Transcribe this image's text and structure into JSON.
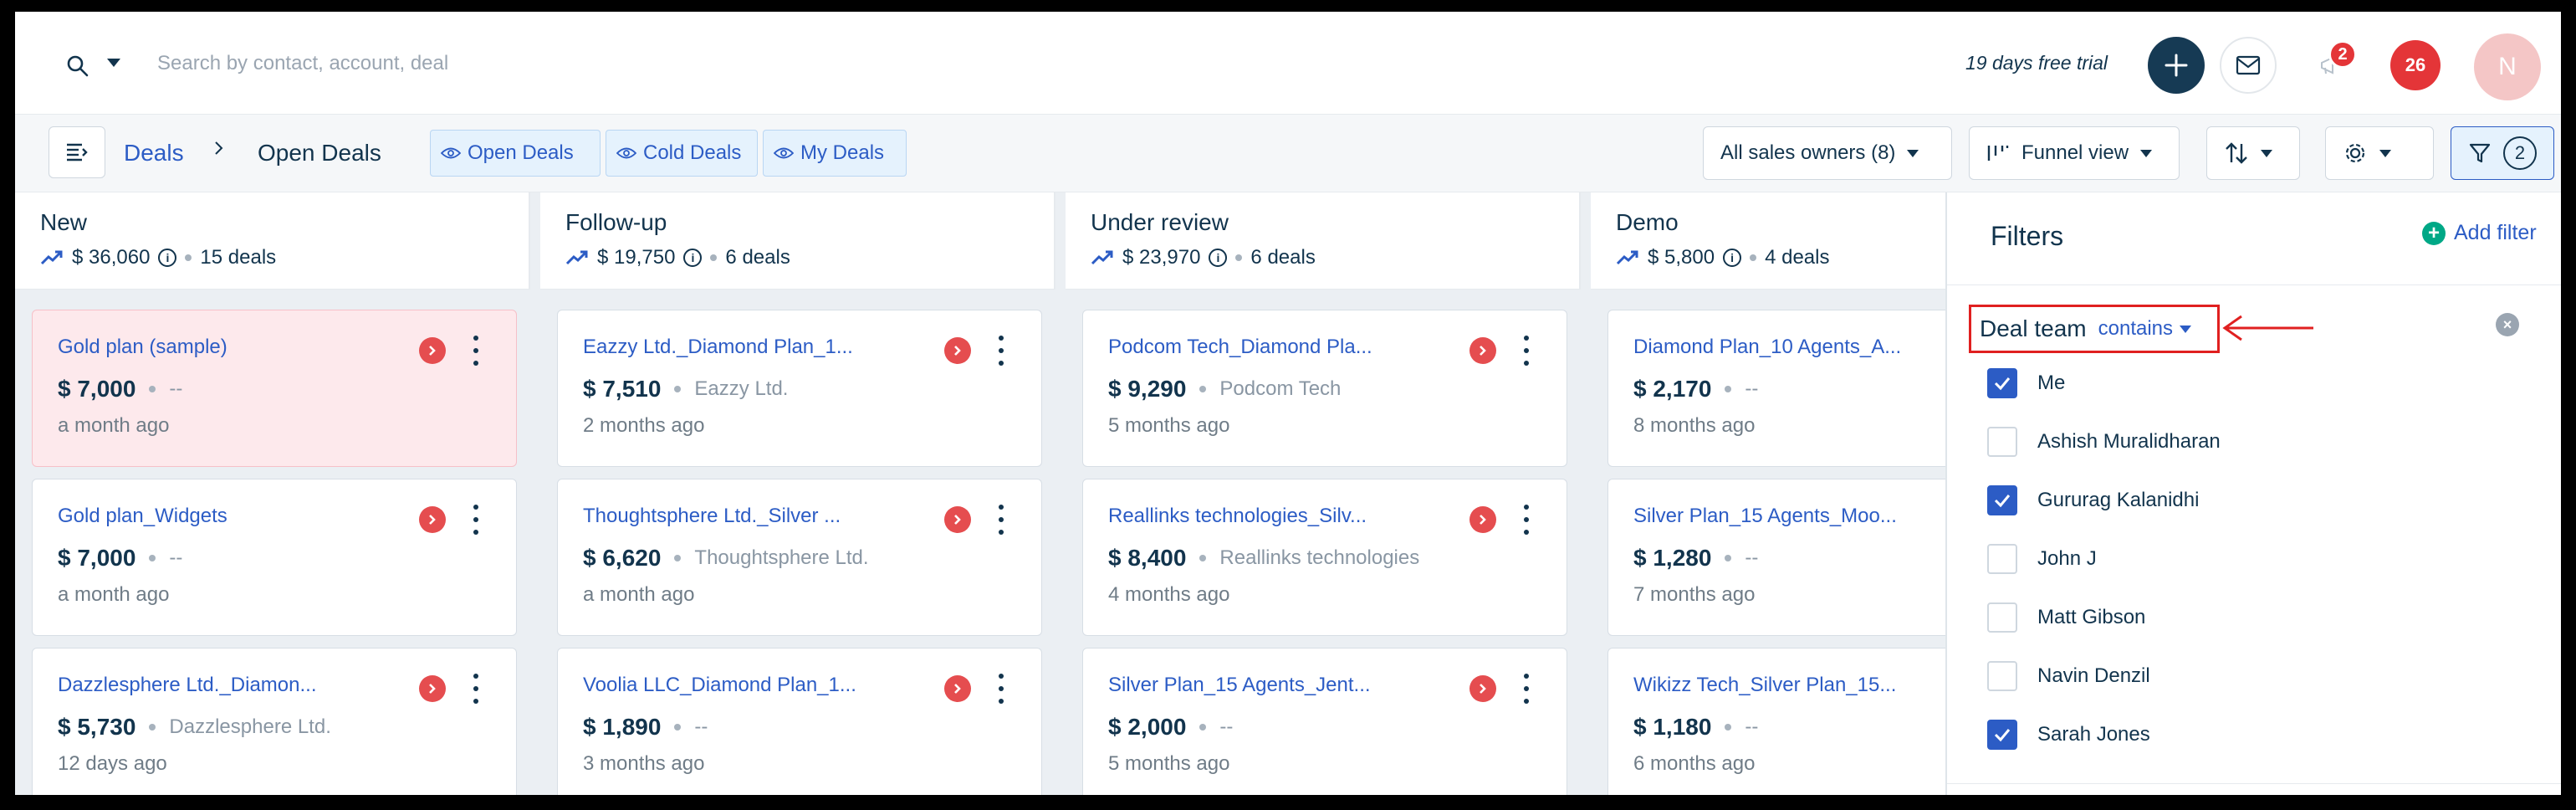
{
  "topbar": {
    "search_placeholder": "Search by contact, account, deal",
    "trial_text": "19 days free trial",
    "notification_count": "2",
    "alerts_count": "26",
    "avatar_initial": "N"
  },
  "subheader": {
    "breadcrumb_root": "Deals",
    "breadcrumb_current": "Open Deals",
    "view_chips": [
      "Open Deals",
      "Cold Deals",
      "My Deals"
    ],
    "owners_label": "All sales owners (8)",
    "view_mode_label": "Funnel view",
    "filter_count": "2"
  },
  "columns": [
    {
      "title": "New",
      "amount": "$ 36,060",
      "count": "15 deals",
      "cards": [
        {
          "title": "Gold plan (sample)",
          "amount": "$ 7,000",
          "account": "--",
          "time": "a month ago"
        },
        {
          "title": "Gold plan_Widgets",
          "amount": "$ 7,000",
          "account": "--",
          "time": "a month ago"
        },
        {
          "title": "Dazzlesphere Ltd._Diamon...",
          "amount": "$ 5,730",
          "account": "Dazzlesphere Ltd.",
          "time": "12 days ago"
        }
      ]
    },
    {
      "title": "Follow-up",
      "amount": "$ 19,750",
      "count": "6 deals",
      "cards": [
        {
          "title": "Eazzy Ltd._Diamond Plan_1...",
          "amount": "$ 7,510",
          "account": "Eazzy Ltd.",
          "time": "2 months ago"
        },
        {
          "title": "Thoughtsphere Ltd._Silver ...",
          "amount": "$ 6,620",
          "account": "Thoughtsphere Ltd.",
          "time": "a month ago"
        },
        {
          "title": "Voolia LLC_Diamond Plan_1...",
          "amount": "$ 1,890",
          "account": "--",
          "time": "3 months ago"
        }
      ]
    },
    {
      "title": "Under review",
      "amount": "$ 23,970",
      "count": "6 deals",
      "cards": [
        {
          "title": "Podcom Tech_Diamond Pla...",
          "amount": "$ 9,290",
          "account": "Podcom Tech",
          "time": "5 months ago"
        },
        {
          "title": "Reallinks technologies_Silv...",
          "amount": "$ 8,400",
          "account": "Reallinks technologies",
          "time": "4 months ago"
        },
        {
          "title": "Silver Plan_15 Agents_Jent...",
          "amount": "$ 2,000",
          "account": "--",
          "time": "5 months ago"
        }
      ]
    },
    {
      "title": "Demo",
      "amount": "$ 5,800",
      "count": "4 deals",
      "cards": [
        {
          "title": "Diamond Plan_10 Agents_A...",
          "amount": "$ 2,170",
          "account": "--",
          "time": "8 months ago"
        },
        {
          "title": "Silver Plan_15 Agents_Moo...",
          "amount": "$ 1,280",
          "account": "--",
          "time": "7 months ago"
        },
        {
          "title": "Wikizz Tech_Silver Plan_15...",
          "amount": "$ 1,180",
          "account": "--",
          "time": "6 months ago"
        }
      ]
    }
  ],
  "filters": {
    "title": "Filters",
    "add_filter_label": "Add filter",
    "field_label": "Deal team",
    "operator_label": "contains",
    "options": [
      {
        "label": "Me",
        "checked": true
      },
      {
        "label": "Ashish Muralidharan",
        "checked": false
      },
      {
        "label": "Gururag Kalanidhi",
        "checked": true
      },
      {
        "label": "John J",
        "checked": false
      },
      {
        "label": "Matt Gibson",
        "checked": false
      },
      {
        "label": "Navin Denzil",
        "checked": false
      },
      {
        "label": "Sarah Jones",
        "checked": true
      }
    ]
  },
  "colors": {
    "accent": "#2c5cc5",
    "highlight_card": "#fde9ec",
    "annotation_red": "#e02020"
  }
}
